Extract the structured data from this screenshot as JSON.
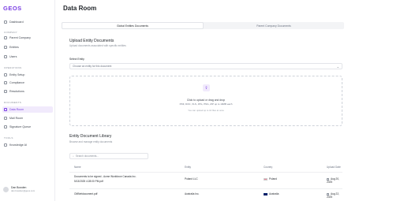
{
  "app": {
    "logo": "GEOS"
  },
  "sidebar": {
    "top": [
      {
        "label": "Dashboard",
        "icon": "home-icon"
      }
    ],
    "sections": [
      {
        "title": "COMPANY",
        "items": [
          "Parent Company",
          "Entities",
          "Users"
        ]
      },
      {
        "title": "OPERATIONS",
        "items": [
          "Entity Setup",
          "Compliance",
          "Resolutions"
        ]
      },
      {
        "title": "DOCUMENTS",
        "items": [
          "Data Room",
          "Mail Room",
          "Signature Queue"
        ]
      },
      {
        "title": "TOOLS",
        "items": [
          "Knowledge AI"
        ]
      }
    ],
    "active": "Data Room",
    "user": {
      "name": "Dan Bowden",
      "email": "dan.bowden@geos.com"
    }
  },
  "main": {
    "title": "Data Room",
    "tabs": [
      {
        "label": "Global Entities Documents",
        "active": true
      },
      {
        "label": "Parent Company Documents",
        "active": false
      }
    ],
    "upload": {
      "title": "Upload Entity Documents",
      "subtitle": "Upload documents associated with specific entities",
      "select_label": "Select Entity",
      "select_placeholder": "Choose an entity for this document",
      "dropzone_main": "Click to upload or drag and drop",
      "dropzone_formats": "PDF, DOC, XLS, JPG, PNG, ZIP up to 10MB each",
      "dropzone_hint": "You can upload up to 10 files at once"
    },
    "library": {
      "title": "Entity Document Library",
      "subtitle": "Browse and manage entity documents",
      "search_placeholder": "Search documents...",
      "columns": [
        "Name",
        "Entity",
        "Country",
        "Upload Date"
      ],
      "rows": [
        {
          "name_1": "Documents to be signed - Acme Workforce Canada Inc.",
          "name_2": "5/13/2025 4:28:00 PM.pdf",
          "entity": "Poland LLC",
          "country": "Poland",
          "flag": "poland",
          "date": "Aug 20, 2025"
        },
        {
          "name_1": "OMNetdocument.pdf",
          "name_2": "",
          "entity": "Australia Inc.",
          "country": "Australia",
          "flag": "australia",
          "date": "Aug 22, 2025"
        }
      ]
    }
  },
  "colors": {
    "accent": "#7b3fe4",
    "active_bg": "#f1eafc",
    "border": "#e3e5e9"
  }
}
